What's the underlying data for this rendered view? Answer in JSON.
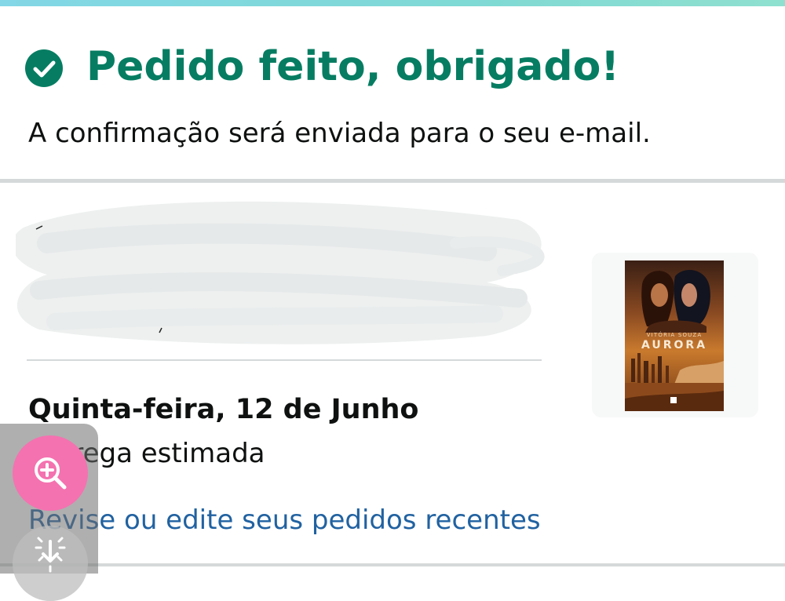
{
  "confirmation": {
    "title": "Pedido feito, obrigado!",
    "subtitle": "A confirmação será enviada para o seu e-mail."
  },
  "product": {
    "cover_author": "VITÓRIA SOUZA",
    "cover_title": "AURORA"
  },
  "delivery": {
    "date": "Quinta-feira, 12 de Junho",
    "label": "Entrega estimada"
  },
  "links": {
    "review_orders": "Revise ou edite seus pedidos recentes"
  },
  "colors": {
    "success_green": "#067d62",
    "link_blue": "#2162a1",
    "zoom_pink": "#f472b0"
  },
  "icons": {
    "confirm": "check-circle-icon",
    "zoom": "zoom-in-icon",
    "download": "download-icon"
  }
}
